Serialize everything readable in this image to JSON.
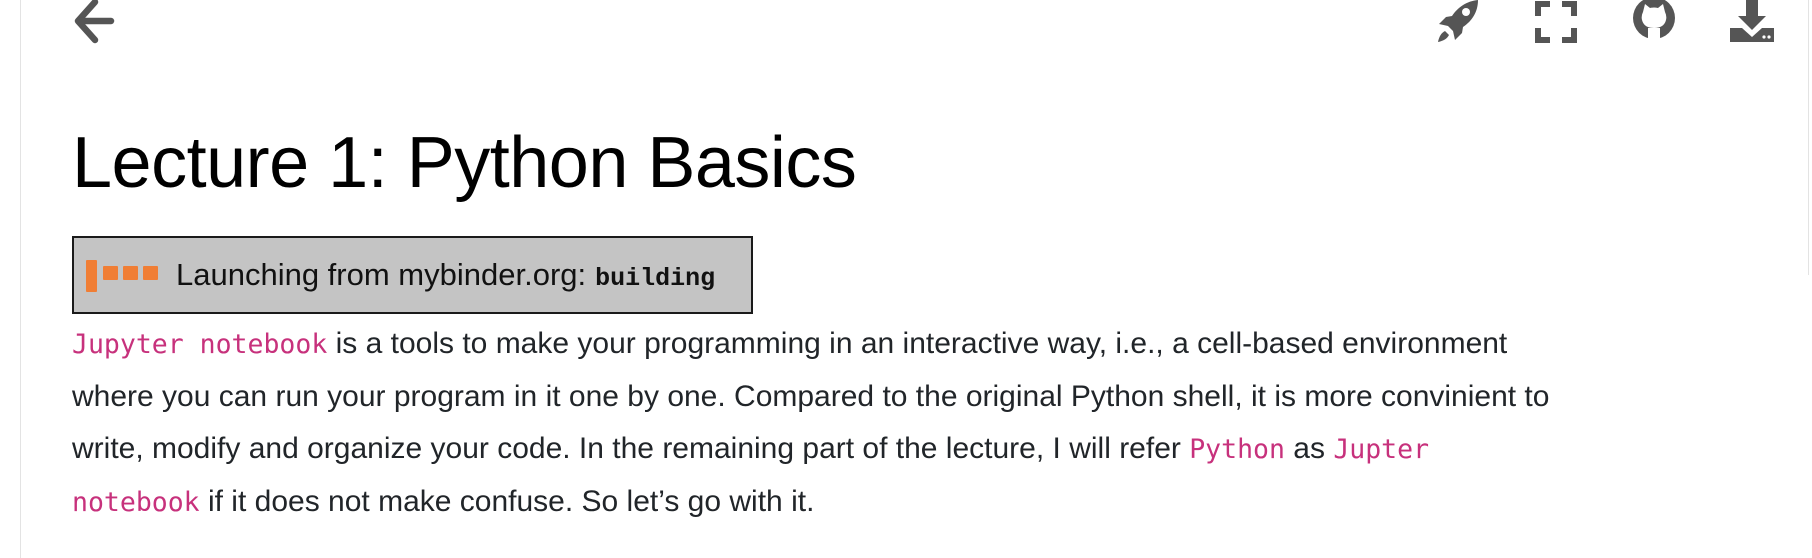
{
  "toolbar": {
    "back_icon": "arrow-left-icon",
    "launch_icon": "rocket-icon",
    "fullscreen_icon": "expand-icon",
    "github_icon": "github-icon",
    "download_icon": "download-icon"
  },
  "page": {
    "title": "Lecture 1: Python Basics"
  },
  "launcher": {
    "label": "Launching from mybinder.org:",
    "status": "building",
    "bar_color": "#f07e35",
    "background": "#c4c4c4"
  },
  "paragraph": {
    "code_1": "Jupyter notebook",
    "text_1": " is a tools to make your programming in an interactive way, i.e., a cell-based environment",
    "text_2": "where you can run your program in it one by one. Compared to the original Python shell, it is more convinient to",
    "text_3": "write, modify and organize your code. In the remaining part of the lecture, I will refer ",
    "code_2": "Python",
    "text_4": " as ",
    "code_3a": "Jupter",
    "code_3b": "notebook",
    "text_5": " if it does not make confuse. So let’s go with it."
  },
  "colors": {
    "inline_code": "#c7317c",
    "icon": "#555555",
    "text": "#212529"
  }
}
